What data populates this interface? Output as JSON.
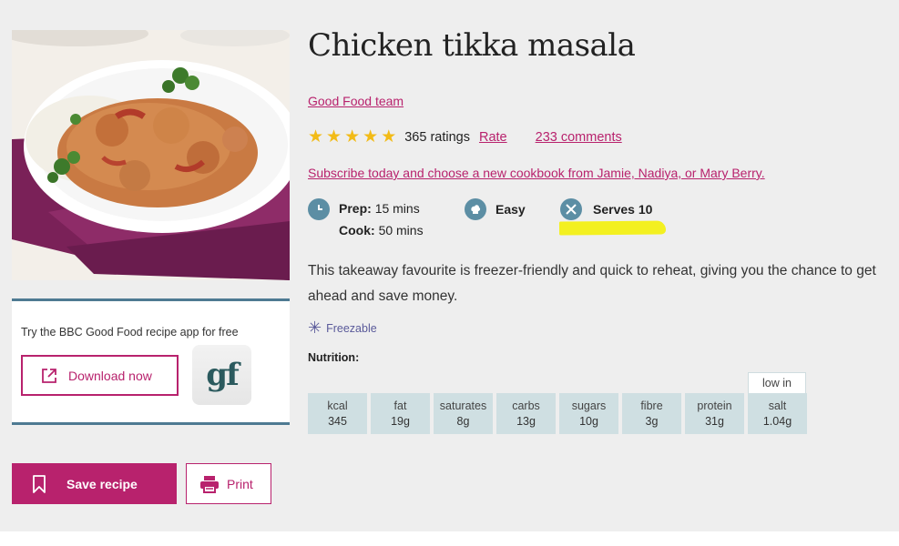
{
  "recipe": {
    "title": "Chicken tikka masala",
    "author": "Good Food team",
    "rating": {
      "stars": 5,
      "ratings_count": "365 ratings",
      "rate_label": "Rate",
      "comments": "233 comments"
    },
    "subscribe_link": "Subscribe today and choose a new cookbook from Jamie, Nadiya, or Mary Berry.",
    "prep_label": "Prep:",
    "prep_value": "15 mins",
    "cook_label": "Cook:",
    "cook_value": "50 mins",
    "difficulty": "Easy",
    "serves": "Serves 10",
    "description": "This takeaway favourite is freezer-friendly and quick to reheat, giving you the chance to get ahead and save money.",
    "freezable": "Freezable",
    "nutrition_label": "Nutrition:",
    "low_in": "low in",
    "nutrition": [
      {
        "name": "kcal",
        "value": "345"
      },
      {
        "name": "fat",
        "value": "19g"
      },
      {
        "name": "saturates",
        "value": "8g"
      },
      {
        "name": "carbs",
        "value": "13g"
      },
      {
        "name": "sugars",
        "value": "10g"
      },
      {
        "name": "fibre",
        "value": "3g"
      },
      {
        "name": "protein",
        "value": "31g"
      },
      {
        "name": "salt",
        "value": "1.04g"
      }
    ]
  },
  "promo": {
    "text": "Try the BBC Good Food recipe app for free",
    "download_label": "Download now",
    "logo_text": "gf"
  },
  "actions": {
    "save_label": "Save recipe",
    "print_label": "Print"
  },
  "colors": {
    "accent": "#b8226d",
    "star": "#f2bb17",
    "info_icon": "#5c8ea4",
    "nutrition_bg": "#cfdfe2",
    "highlight": "#f3f020"
  },
  "icons": {
    "prep": "clock-icon",
    "difficulty": "chef-hat-icon",
    "serves": "cutlery-icon",
    "freezable": "snowflake-icon",
    "download": "external-link-icon",
    "save": "bookmark-icon",
    "print": "printer-icon"
  }
}
